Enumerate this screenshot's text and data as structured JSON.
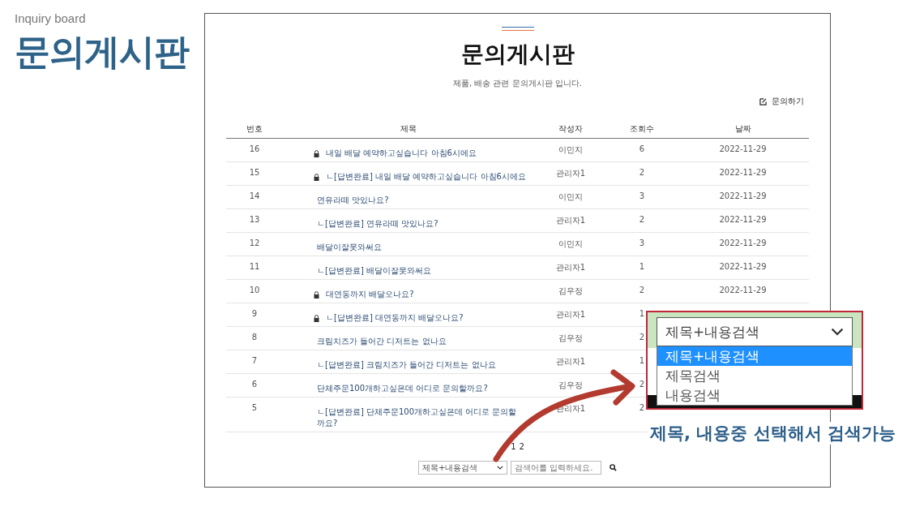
{
  "slide": {
    "subtitle": "Inquiry board",
    "heading": "문의게시판",
    "caption": "제목, 내용중 선택해서 검색가능"
  },
  "board": {
    "title": "문의게시판",
    "description": "제품, 배송 관련 문의게시판 입니다.",
    "write_button": "문의하기",
    "columns": [
      "번호",
      "제목",
      "작성자",
      "조회수",
      "날짜"
    ],
    "rows": [
      {
        "number": "16",
        "title": "내일 배달 예약하고싶습니다 아침6시에요",
        "locked": true,
        "author": "이민지",
        "views": "6",
        "date": "2022-11-29"
      },
      {
        "number": "15",
        "title": "ㄴ[답변완료] 내일 배달 예약하고싶습니다 아침6시에요",
        "locked": true,
        "author": "관리자1",
        "views": "2",
        "date": "2022-11-29"
      },
      {
        "number": "14",
        "title": "연유라떼 맛있나요?",
        "locked": false,
        "author": "이민지",
        "views": "3",
        "date": "2022-11-29"
      },
      {
        "number": "13",
        "title": "ㄴ[답변완료] 연유라떼 맛있나요?",
        "locked": false,
        "author": "관리자1",
        "views": "2",
        "date": "2022-11-29"
      },
      {
        "number": "12",
        "title": "배달이잘못와써요",
        "locked": false,
        "author": "이민지",
        "views": "3",
        "date": "2022-11-29"
      },
      {
        "number": "11",
        "title": "ㄴ[답변완료] 배달이잘못와써요",
        "locked": false,
        "author": "관리자1",
        "views": "1",
        "date": "2022-11-29"
      },
      {
        "number": "10",
        "title": "대연동까지 배달오나요?",
        "locked": true,
        "author": "김우정",
        "views": "2",
        "date": "2022-11-29"
      },
      {
        "number": "9",
        "title": "ㄴ[답변완료] 대연동까지 배달오나요?",
        "locked": true,
        "author": "관리자1",
        "views": "1"
      },
      {
        "number": "8",
        "title": "크림치즈가 들어간 디저트는 없나요",
        "locked": false,
        "author": "김우정",
        "views": "2"
      },
      {
        "number": "7",
        "title": "ㄴ[답변완료] 크림치즈가 들어간 디저트는 없나요",
        "locked": false,
        "author": "관리자1",
        "views": "1"
      },
      {
        "number": "6",
        "title": "단체주문100개하고싶은데 어디로 문의할까요?",
        "locked": false,
        "author": "김우정",
        "views": "2"
      },
      {
        "number": "5",
        "title": "ㄴ[답변완료] 단체주문100개하고싶은데 어디로 문의할까요?",
        "locked": false,
        "author": "관리자1",
        "views": "2"
      }
    ],
    "pagination": [
      "1",
      "2"
    ],
    "search": {
      "scope": "제목+내용검색",
      "placeholder": "검색어를 입력하세요."
    }
  },
  "callout": {
    "select_value": "제목+내용검색",
    "options": [
      {
        "label": "제목+내용검색",
        "selected": true
      },
      {
        "label": "제목검색",
        "selected": false
      },
      {
        "label": "내용검색",
        "selected": false
      }
    ]
  }
}
